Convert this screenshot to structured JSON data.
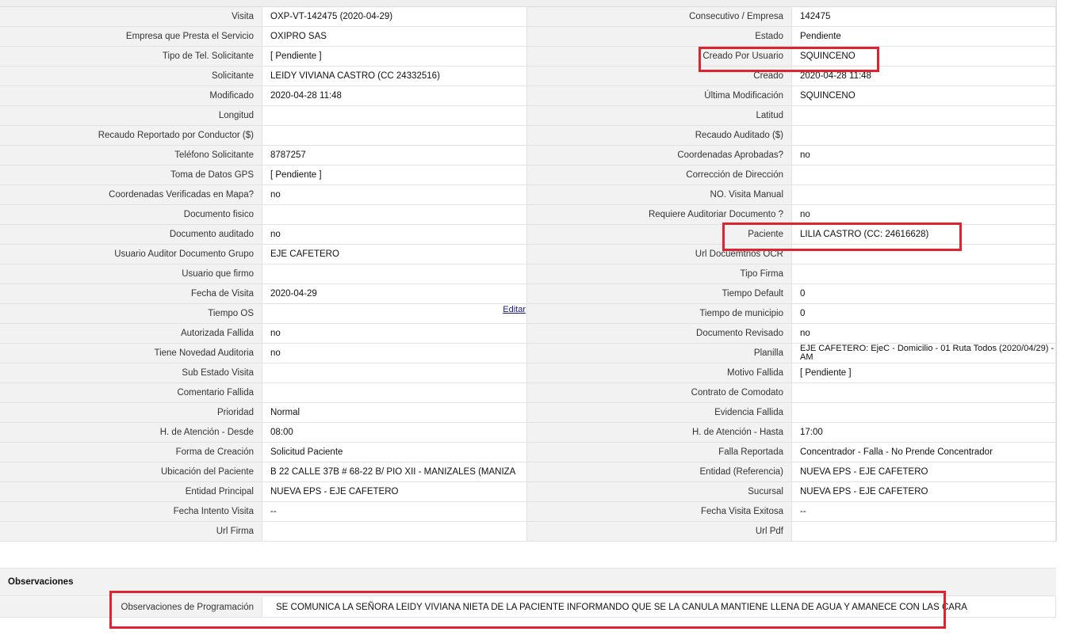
{
  "rows": [
    {
      "l1": "Visita",
      "v1": "OXP-VT-142475 (2020-04-29)",
      "l2": "Consecutivo / Empresa",
      "v2": "142475"
    },
    {
      "l1": "Empresa que Presta el Servicio",
      "v1": "OXIPRO SAS",
      "l2": "Estado",
      "v2": "Pendiente"
    },
    {
      "l1": "Tipo de Tel. Solicitante",
      "v1": "[ Pendiente ]",
      "l2": "Creado Por Usuario",
      "v2": "SQUINCENO"
    },
    {
      "l1": "Solicitante",
      "v1": "LEIDY VIVIANA CASTRO (CC 24332516)",
      "l2": "Creado",
      "v2": "2020-04-28 11:48"
    },
    {
      "l1": "Modificado",
      "v1": "2020-04-28 11:48",
      "l2": "Última Modificación",
      "v2": " SQUINCENO"
    },
    {
      "l1": "Longitud",
      "v1": "",
      "l2": "Latitud",
      "v2": ""
    },
    {
      "l1": "Recaudo Reportado por Conductor ($)",
      "v1": "",
      "l2": "Recaudo Auditado ($)",
      "v2": ""
    },
    {
      "l1": "Teléfono Solicitante",
      "v1": "8787257",
      "l2": "Coordenadas Aprobadas?",
      "v2": " no"
    },
    {
      "l1": "Toma de Datos GPS",
      "v1": "[ Pendiente ]",
      "l2": "Corrección de Dirección",
      "v2": ""
    },
    {
      "l1": "Coordenadas Verificadas en Mapa?",
      "v1": " no",
      "l2": "NO. Visita Manual",
      "v2": ""
    },
    {
      "l1": "Documento fisico",
      "v1": "",
      "l2": "Requiere Auditoriar Documento ?",
      "v2": " no"
    },
    {
      "l1": "Documento auditado",
      "v1": " no",
      "l2": "Paciente",
      "v2": "LILIA CASTRO (CC: 24616628)"
    },
    {
      "l1": "Usuario Auditor Documento Grupo",
      "v1": "EJE CAFETERO",
      "l2": "Url Docuemtnos OCR",
      "v2": ""
    },
    {
      "l1": "Usuario que firmo",
      "v1": "",
      "l2": "Tipo Firma",
      "v2": ""
    },
    {
      "l1": "Fecha de Visita",
      "v1": " 2020-04-29",
      "l2": "Tiempo Default",
      "v2": "0"
    },
    {
      "l1": "Tiempo OS",
      "v1": "",
      "l2": "Tiempo de municipio",
      "v2": "0"
    },
    {
      "l1": "Autorizada Fallida",
      "v1": " no",
      "l2": "Documento Revisado",
      "v2": " no"
    },
    {
      "l1": "Tiene Novedad Auditoria",
      "v1": " no",
      "l2": "Planilla",
      "v2": "EJE CAFETERO: EjeC - Domicilio - 01 Ruta Todos (2020/04/29) - AM"
    },
    {
      "l1": "Sub Estado Visita",
      "v1": "",
      "l2": "Motivo Fallida",
      "v2": "[ Pendiente ]"
    },
    {
      "l1": "Comentario Fallida",
      "v1": "",
      "l2": "Contrato de Comodato",
      "v2": ""
    },
    {
      "l1": "Prioridad",
      "v1": "Normal",
      "l2": "Evidencia Fallida",
      "v2": ""
    },
    {
      "l1": "H. de Atención - Desde",
      "v1": "08:00",
      "l2": "H. de Atención - Hasta",
      "v2": "17:00"
    },
    {
      "l1": "Forma de Creación",
      "v1": "Solicitud Paciente",
      "l2": "Falla Reportada",
      "v2": "Concentrador - Falla - No Prende Concentrador"
    },
    {
      "l1": "Ubicación del Paciente",
      "v1": "B 22 CALLE 37B # 68-22 B/ PIO XII - MANIZALES (MANIZA",
      "l2": "Entidad (Referencia)",
      "v2": "NUEVA EPS - EJE CAFETERO"
    },
    {
      "l1": "Entidad Principal",
      "v1": "NUEVA EPS - EJE CAFETERO",
      "l2": "Sucursal",
      "v2": "NUEVA EPS - EJE CAFETERO"
    },
    {
      "l1": "Fecha Intento Visita",
      "v1": " --",
      "l2": "Fecha Visita Exitosa",
      "v2": " --"
    },
    {
      "l1": "Url Firma",
      "v1": "",
      "l2": "Url Pdf",
      "v2": ""
    }
  ],
  "edit_link": "Editar",
  "observaciones": {
    "section_title": "Observaciones",
    "label": "Observaciones de Programación",
    "value": "SE COMUNICA LA SEÑORA LEIDY VIVIANA NIETA DE LA PACIENTE INFORMANDO QUE SE LA CANULA MANTIENE LLENA DE AGUA Y AMANECE CON LAS CARA"
  },
  "colors": {
    "highlight": "#e0242f",
    "label_bg": "#f2f2f2"
  }
}
